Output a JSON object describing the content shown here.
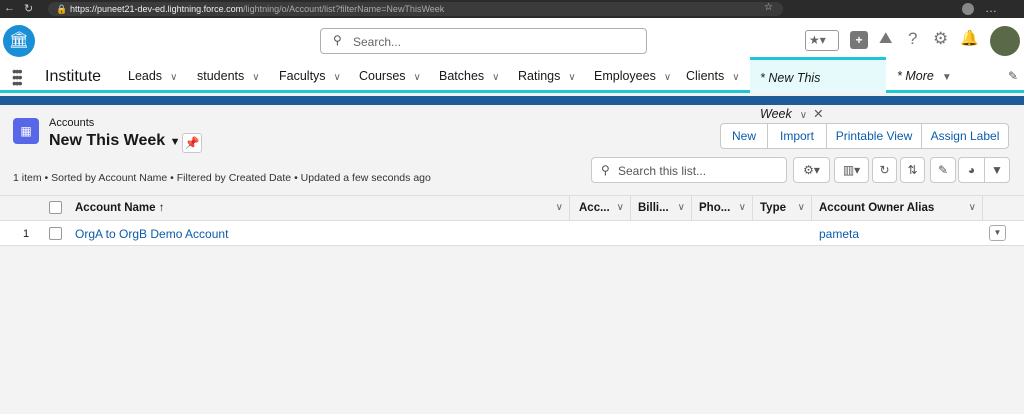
{
  "browser": {
    "url_host": "https://puneet21-dev-ed.lightning.force.com",
    "url_path": "/lightning/o/Account/list?filterName=NewThisWeek"
  },
  "header": {
    "search_placeholder": "Search..."
  },
  "nav": {
    "app_name": "Institute",
    "items": [
      {
        "label": "Leads"
      },
      {
        "label": "students"
      },
      {
        "label": "Facultys"
      },
      {
        "label": "Courses"
      },
      {
        "label": "Batches"
      },
      {
        "label": "Ratings"
      },
      {
        "label": "Employees"
      },
      {
        "label": "Clients"
      }
    ],
    "active_tab": "* New This Week",
    "more": "* More"
  },
  "list": {
    "object": "Accounts",
    "view": "New This Week",
    "buttons": [
      "New",
      "Import",
      "Printable View",
      "Assign Label"
    ],
    "search_placeholder": "Search this list...",
    "status": "1 item • Sorted by Account Name • Filtered by Created Date • Updated a few seconds ago"
  },
  "table": {
    "columns": [
      "Account Name",
      "Acc...",
      "Billi...",
      "Pho...",
      "Type",
      "Account Owner Alias"
    ],
    "sort_indicator": "↑",
    "rows": [
      {
        "num": "1",
        "name": "OrgA to OrgB Demo Account",
        "owner": "pameta"
      }
    ]
  },
  "colors": {
    "brand": "#0b5cab",
    "accent": "#1fc7d4",
    "band": "#1d5c96",
    "object_icon": "#5867e8"
  }
}
